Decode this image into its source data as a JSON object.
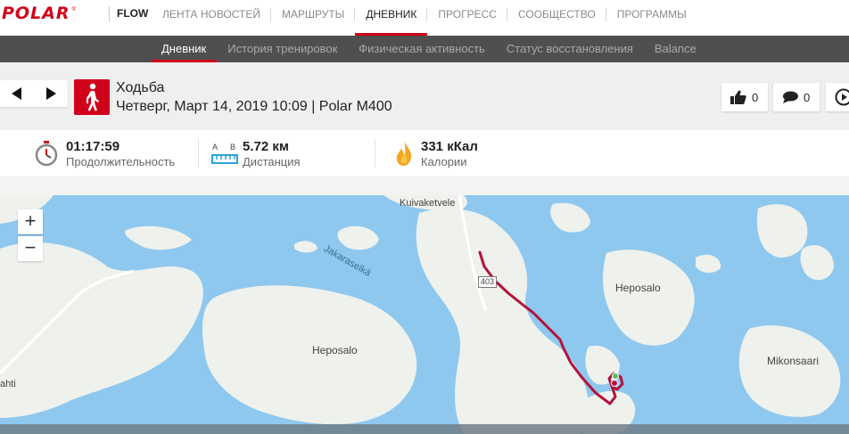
{
  "brand": {
    "logo_text": "POLAR",
    "registered": "®",
    "app_name": "FLOW",
    "accent": "#d0021b"
  },
  "top_nav": {
    "items": [
      {
        "label": "ЛЕНТА НОВОСТЕЙ",
        "active": false
      },
      {
        "label": "МАРШРУТЫ",
        "active": false
      },
      {
        "label": "ДНЕВНИК",
        "active": true
      },
      {
        "label": "ПРОГРЕСС",
        "active": false
      },
      {
        "label": "СООБЩЕСТВО",
        "active": false
      },
      {
        "label": "ПРОГРАММЫ",
        "active": false
      }
    ]
  },
  "sub_nav": {
    "items": [
      {
        "label": "Дневник",
        "active": true
      },
      {
        "label": "История тренировок",
        "active": false
      },
      {
        "label": "Физическая активность",
        "active": false
      },
      {
        "label": "Статус восстановления",
        "active": false
      },
      {
        "label": "Balance",
        "active": false
      }
    ]
  },
  "session": {
    "sport": "Ходьба",
    "meta": "Четверг, Март 14, 2019 10:09 | Polar M400",
    "likes": "0",
    "comments": "0",
    "icon": "walking-person-icon"
  },
  "summary": {
    "duration": {
      "value": "01:17:59",
      "label": "Продолжительность",
      "icon": "stopwatch-icon"
    },
    "distance": {
      "value": "5.72 км",
      "label": "Дистанция",
      "icon": "distance-ruler-icon",
      "marker_a": "A",
      "marker_b": "B"
    },
    "calories": {
      "value": "331 кКал",
      "label": "Калории",
      "icon": "flame-icon"
    }
  },
  "map": {
    "labels": [
      {
        "text": "Kuivaketvele"
      },
      {
        "text": "Jakaraselkä"
      },
      {
        "text": "Heposalo"
      },
      {
        "text": "Heposalo"
      },
      {
        "text": "Mikonsaari"
      },
      {
        "text": "ahti"
      },
      {
        "text": "403"
      }
    ],
    "zoom_in": "+",
    "zoom_out": "−",
    "water_color": "#8ec8ef",
    "land_color": "#eef1ec",
    "route_color": "#b4123a"
  }
}
